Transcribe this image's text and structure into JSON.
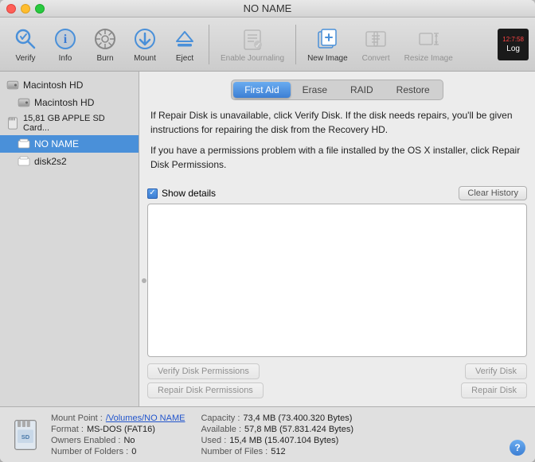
{
  "window": {
    "title": "NO NAME"
  },
  "toolbar": {
    "buttons": [
      {
        "id": "verify",
        "label": "Verify",
        "icon": "verify-icon",
        "disabled": false
      },
      {
        "id": "info",
        "label": "Info",
        "icon": "info-icon",
        "disabled": false
      },
      {
        "id": "burn",
        "label": "Burn",
        "icon": "burn-icon",
        "disabled": false
      },
      {
        "id": "mount",
        "label": "Mount",
        "icon": "mount-icon",
        "disabled": false
      },
      {
        "id": "eject",
        "label": "Eject",
        "icon": "eject-icon",
        "disabled": false
      },
      {
        "id": "enable-journaling",
        "label": "Enable Journaling",
        "icon": "journaling-icon",
        "disabled": true
      },
      {
        "id": "new-image",
        "label": "New Image",
        "icon": "newimage-icon",
        "disabled": false
      },
      {
        "id": "convert",
        "label": "Convert",
        "icon": "convert-icon",
        "disabled": true
      },
      {
        "id": "resize-image",
        "label": "Resize Image",
        "icon": "resize-icon",
        "disabled": true
      }
    ],
    "log": {
      "time": "12:7:58",
      "label": "Log"
    }
  },
  "sidebar": {
    "items": [
      {
        "id": "macintosh-hd-parent",
        "label": "Macintosh HD",
        "type": "hd",
        "indent": 0
      },
      {
        "id": "macintosh-hd-child",
        "label": "Macintosh HD",
        "type": "hd",
        "indent": 1
      },
      {
        "id": "sd-card",
        "label": "15,81 GB APPLE SD Card...",
        "type": "sd",
        "indent": 0
      },
      {
        "id": "no-name",
        "label": "NO NAME",
        "type": "volume",
        "indent": 1,
        "selected": true
      },
      {
        "id": "disk2s2",
        "label": "disk2s2",
        "type": "volume",
        "indent": 1
      }
    ]
  },
  "main": {
    "tabs": [
      {
        "id": "first-aid",
        "label": "First Aid",
        "active": true
      },
      {
        "id": "erase",
        "label": "Erase",
        "active": false
      },
      {
        "id": "raid",
        "label": "RAID",
        "active": false
      },
      {
        "id": "restore",
        "label": "Restore",
        "active": false
      }
    ],
    "info_text_1": "If Repair Disk is unavailable, click Verify Disk. If the disk needs repairs, you'll be given instructions for repairing the disk from the Recovery HD.",
    "info_text_2": "If you have a permissions problem with a file installed by the OS X installer, click Repair Disk Permissions.",
    "show_details_label": "Show details",
    "clear_history_label": "Clear History",
    "buttons": {
      "verify_permissions": "Verify Disk Permissions",
      "verify_disk": "Verify Disk",
      "repair_permissions": "Repair Disk Permissions",
      "repair_disk": "Repair Disk"
    }
  },
  "status": {
    "mount_point_label": "Mount Point :",
    "mount_point_value": "/Volumes/NO NAME",
    "format_label": "Format :",
    "format_value": "MS-DOS (FAT16)",
    "owners_label": "Owners Enabled :",
    "owners_value": "No",
    "folders_label": "Number of Folders :",
    "folders_value": "0",
    "capacity_label": "Capacity :",
    "capacity_value": "73,4 MB (73.400.320 Bytes)",
    "available_label": "Available :",
    "available_value": "57,8 MB (57.831.424 Bytes)",
    "used_label": "Used :",
    "used_value": "15,4 MB (15.407.104 Bytes)",
    "files_label": "Number of Files :",
    "files_value": "512"
  }
}
